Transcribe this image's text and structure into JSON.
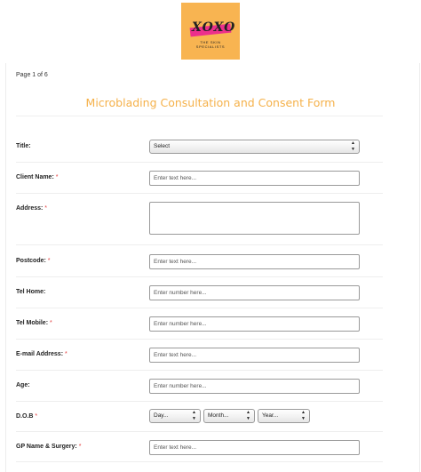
{
  "logo": {
    "mark": "XOXO",
    "tagline": "THE SKIN SPECIALISTS"
  },
  "page_indicator": "Page 1 of 6",
  "form_title": "Microblading Consultation and Consent Form",
  "required_marker": "*",
  "fields": {
    "title": {
      "label": "Title:",
      "value": "Select"
    },
    "client_name": {
      "label": "Client Name:",
      "placeholder": "Enter text here..."
    },
    "address": {
      "label": "Address:",
      "placeholder": ""
    },
    "postcode": {
      "label": "Postcode:",
      "placeholder": "Enter text here..."
    },
    "tel_home": {
      "label": "Tel Home:",
      "placeholder": "Enter number here..."
    },
    "tel_mobile": {
      "label": "Tel Mobile:",
      "placeholder": "Enter number here..."
    },
    "email": {
      "label": "E-mail Address:",
      "placeholder": "Enter text here..."
    },
    "age": {
      "label": "Age:",
      "placeholder": "Enter number here..."
    },
    "dob": {
      "label": "D.O.B",
      "day": "Day...",
      "month": "Month...",
      "year": "Year..."
    },
    "gp": {
      "label": "GP Name & Surgery:",
      "placeholder": "Enter text here..."
    }
  },
  "colors": {
    "accent": "#f5b14a",
    "logo_bg": "#f8b451",
    "logo_stripe": "#ec2f8c",
    "required": "#e23b3b"
  }
}
